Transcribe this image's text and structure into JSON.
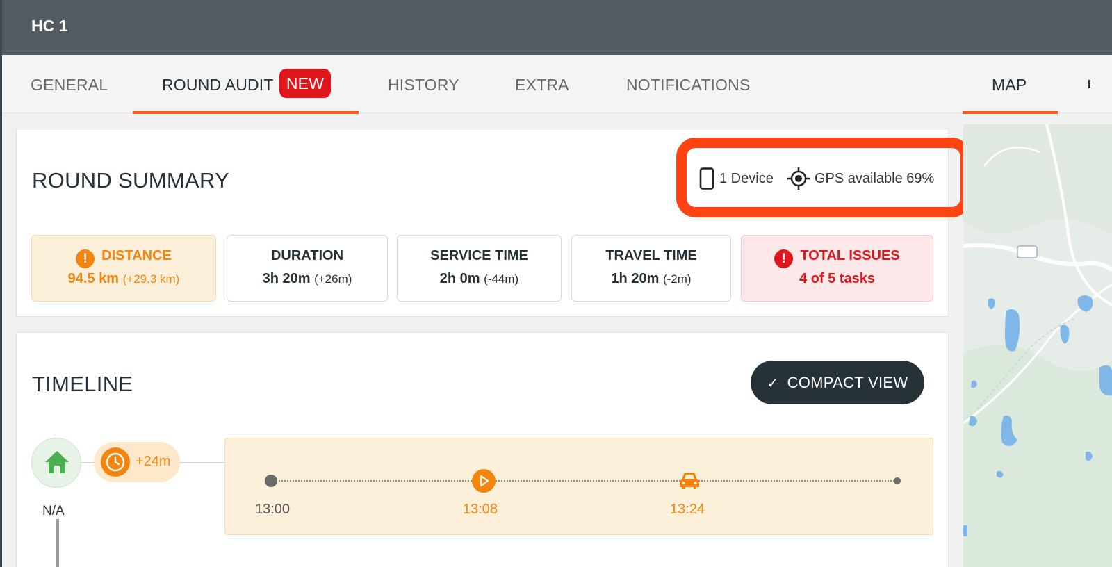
{
  "window": {
    "title": "HC 1"
  },
  "tabs": [
    {
      "label": "GENERAL"
    },
    {
      "label": "ROUND AUDIT",
      "badge": "NEW"
    },
    {
      "label": "HISTORY"
    },
    {
      "label": "EXTRA"
    },
    {
      "label": "NOTIFICATIONS"
    },
    {
      "label": "MAP"
    }
  ],
  "summary": {
    "title": "ROUND SUMMARY",
    "device_label": "1 Device",
    "gps_label": "GPS available 69%",
    "stats": [
      {
        "label": "DISTANCE",
        "value": "94.5 km",
        "delta": "(+29.3 km)",
        "status": "warning"
      },
      {
        "label": "DURATION",
        "value": "3h 20m",
        "delta": "(+26m)",
        "status": "normal"
      },
      {
        "label": "SERVICE TIME",
        "value": "2h 0m",
        "delta": "(-44m)",
        "status": "normal"
      },
      {
        "label": "TRAVEL TIME",
        "value": "1h 20m",
        "delta": "(-2m)",
        "status": "normal"
      },
      {
        "label": "TOTAL ISSUES",
        "value": "4 of 5 tasks",
        "delta": "",
        "status": "error"
      }
    ]
  },
  "timeline": {
    "title": "TIMELINE",
    "compact_view_label": "COMPACT VIEW",
    "home_label": "N/A",
    "delay_label": "+24m",
    "events": [
      {
        "time": "13:00",
        "icon": "start-dot-icon"
      },
      {
        "time": "13:08",
        "icon": "play-icon"
      },
      {
        "time": "13:24",
        "icon": "car-icon"
      }
    ]
  },
  "colors": {
    "accent": "#ff5722",
    "warning": "#f5840c",
    "error": "#e0161d",
    "dark": "#263238",
    "highlight": "#ff4413"
  }
}
